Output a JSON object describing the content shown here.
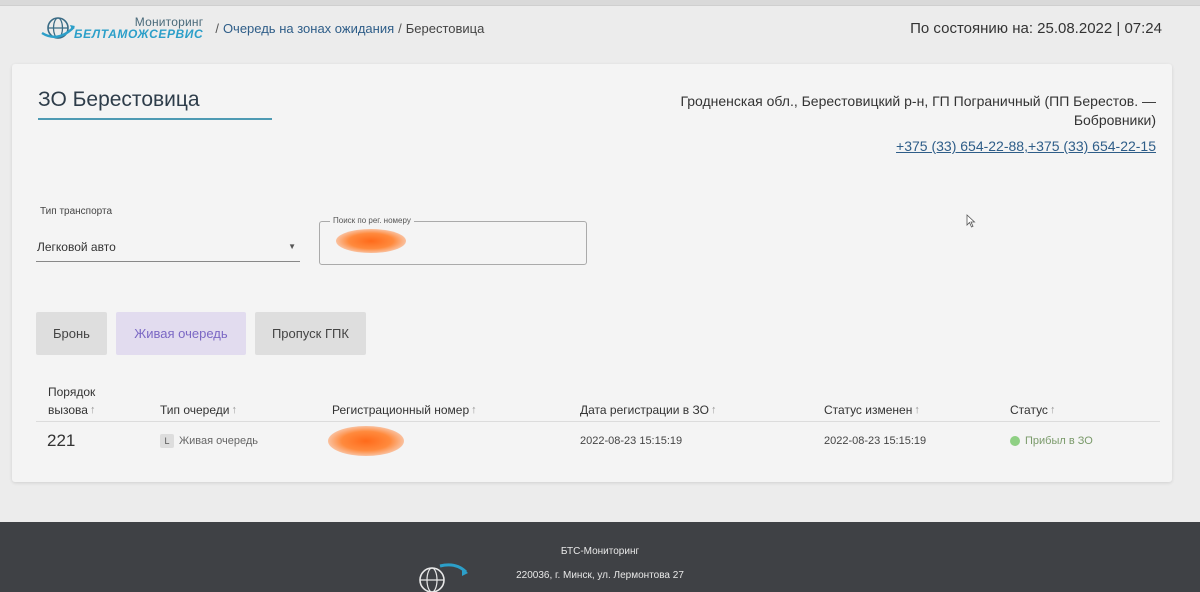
{
  "header": {
    "logo": {
      "top": "Мониторинг",
      "bottom": "БЕЛТАМОЖСЕРВИС"
    },
    "breadcrumb": [
      {
        "label": "Очередь на зонах ожидания"
      },
      {
        "label": "Берестовица"
      }
    ],
    "status_date": "По состоянию на: 25.08.2022 | 07:24"
  },
  "zone": {
    "title": "ЗО Берестовица",
    "address": "Гродненская обл., Берестовицкий р-н, ГП Пограничный (ПП Берестов. — Бобровники)",
    "phones": "+375 (33) 654-22-88,+375 (33) 654-22-15"
  },
  "filters": {
    "transport_label": "Тип транспорта",
    "transport_value": "Легковой авто",
    "search_legend": "Поиск по рег. номеру",
    "search_value": ""
  },
  "tabs": [
    {
      "label": "Бронь",
      "active": false
    },
    {
      "label": "Живая очередь",
      "active": true
    },
    {
      "label": "Пропуск ГПК",
      "active": false
    }
  ],
  "table": {
    "headers": {
      "order_1": "Порядок",
      "order_2": "вызова",
      "type": "Тип очереди",
      "reg": "Регистрационный номер",
      "date": "Дата регистрации в ЗО",
      "changed": "Статус изменен",
      "status": "Статус"
    },
    "sort_arrow": "↑",
    "rows": [
      {
        "order": "221",
        "type_badge": "L",
        "type": "Живая очередь",
        "reg": "",
        "date": "2022-08-23 15:15:19",
        "changed": "2022-08-23 15:15:19",
        "status": "Прибыл в ЗО",
        "status_color": "#8fd084"
      }
    ]
  },
  "footer": {
    "title": "БТС-Мониторинг",
    "address": "220036, г. Минск, ул. Лермонтова 27"
  },
  "colors": {
    "accent": "#2c9fc9",
    "active_tab": "#7b68c4",
    "footer_bg": "#3f4145"
  }
}
